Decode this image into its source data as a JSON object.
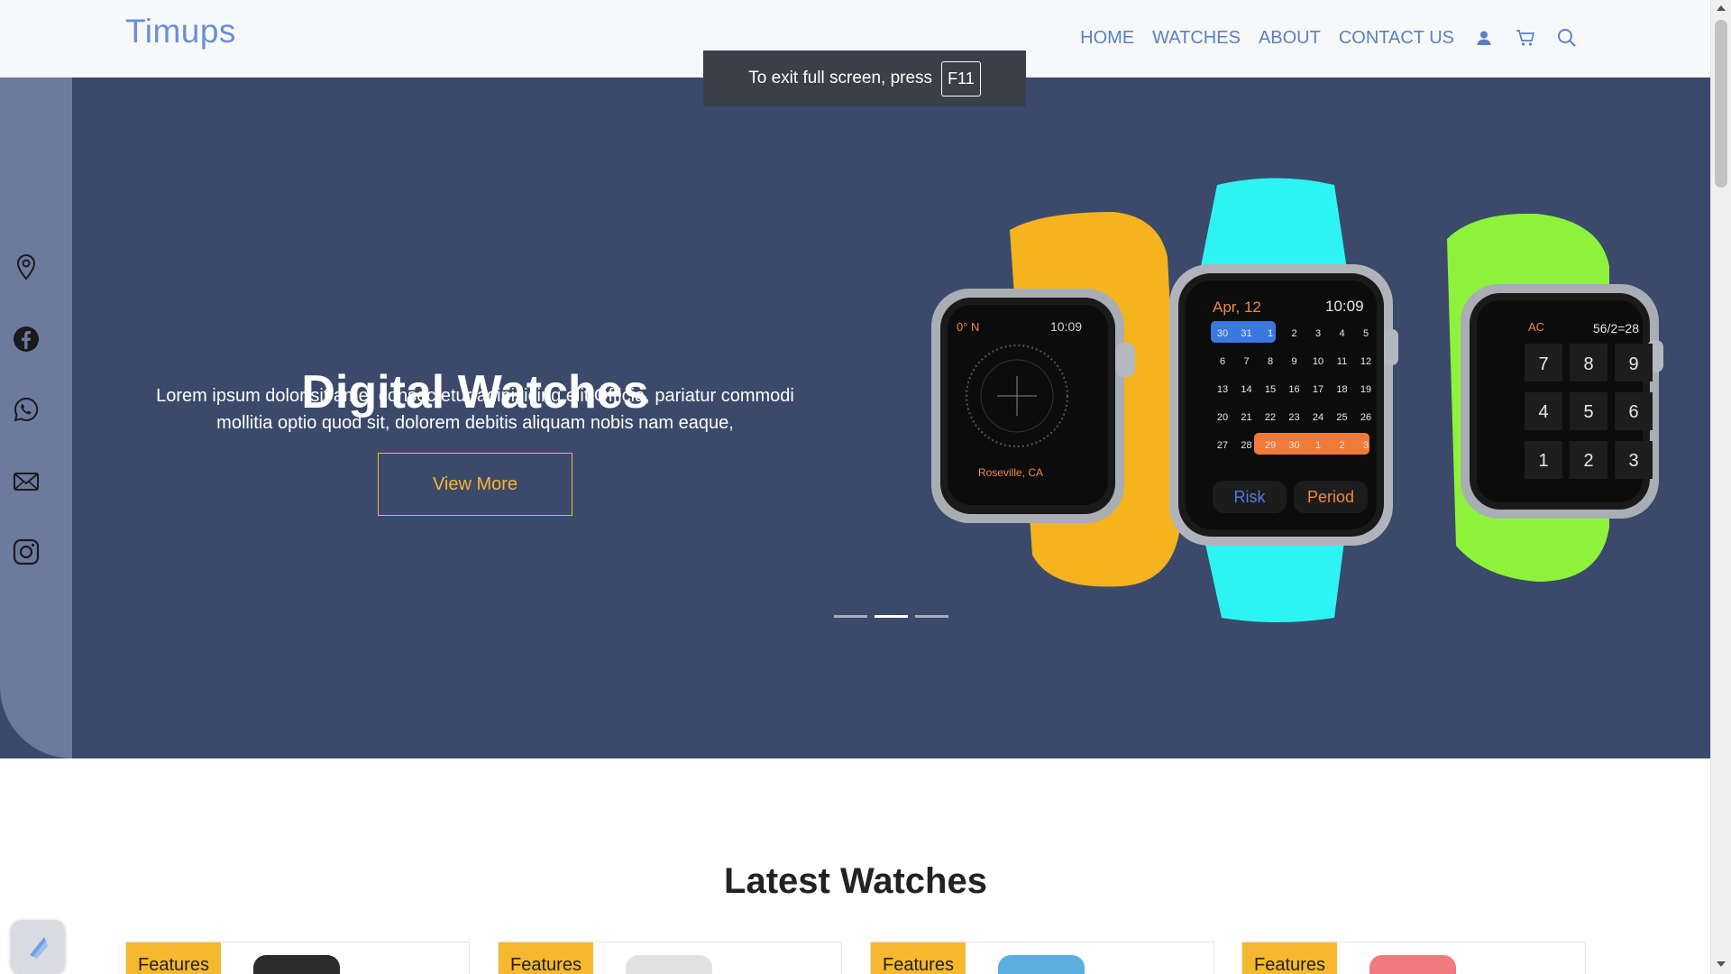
{
  "header": {
    "brand": "Timups",
    "nav": [
      "HOME",
      "WATCHES",
      "ABOUT",
      "CONTACT US"
    ],
    "icons": [
      "user-icon",
      "cart-icon",
      "search-icon"
    ]
  },
  "toast": {
    "message": "To exit full screen, press",
    "key": "F11"
  },
  "sidebar": {
    "icons": [
      "location-icon",
      "facebook-icon",
      "whatsapp-icon",
      "mail-icon",
      "instagram-icon"
    ]
  },
  "hero": {
    "title": "Digital Watches",
    "text": "Lorem ipsum dolor sit amet consectetur adipisicing elit.Officia, pariatur commodi mollitia optio quod sit, dolorem debitis aliquam nobis nam eaque,",
    "button": "View More",
    "slides": 3,
    "active_slide": 2
  },
  "watch_faces": {
    "compass": {
      "heading": "0° N",
      "time": "10:09",
      "location": "Roseville, CA"
    },
    "calendar": {
      "date": "Apr, 12",
      "time": "10:09",
      "left_label": "Risk",
      "right_label": "Period",
      "rows": [
        [
          "30",
          "31",
          "1",
          "2",
          "3",
          "4",
          "5"
        ],
        [
          "6",
          "7",
          "8",
          "9",
          "10",
          "11",
          "12"
        ],
        [
          "13",
          "14",
          "15",
          "16",
          "17",
          "18",
          "19"
        ],
        [
          "20",
          "21",
          "22",
          "23",
          "24",
          "25",
          "26"
        ],
        [
          "27",
          "28",
          "29",
          "30",
          "1",
          "2",
          "3"
        ]
      ]
    },
    "calculator": {
      "clear": "AC",
      "display": "56/2=28",
      "keys": [
        "7",
        "8",
        "9",
        "4",
        "5",
        "6",
        "1",
        "2",
        "3"
      ]
    }
  },
  "latest": {
    "title": "Latest Watches",
    "cards": [
      {
        "tag": "Features",
        "color": "#2b2b2b"
      },
      {
        "tag": "Features",
        "color": "#e2e2e2"
      },
      {
        "tag": "Features",
        "color": "#5aaee0"
      },
      {
        "tag": "Features",
        "color": "#f07a80"
      }
    ]
  },
  "colors": {
    "accent": "#f5b82e",
    "hero_bg": "#3b4a6b",
    "brand": "#6b8fd6"
  }
}
